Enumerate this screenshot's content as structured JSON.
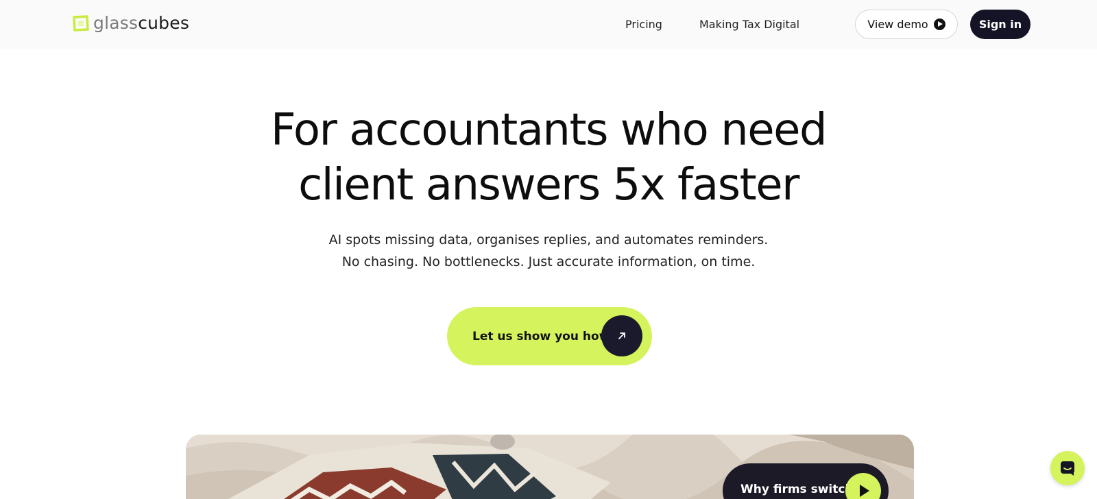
{
  "brand": {
    "name_light": "glass",
    "name_dark": "cubes",
    "accent": "#d5f35d",
    "dark": "#141426"
  },
  "nav": {
    "links": [
      "Pricing",
      "Making Tax Digital"
    ],
    "demo_label": "View demo",
    "signin_label": "Sign in"
  },
  "hero": {
    "title_line1": "For accountants who need",
    "title_line2_plain": "client answers ",
    "title_line2_highlight": "5x faster",
    "subtitle_line1": "AI spots missing data, organises replies, and automates reminders.",
    "subtitle_line2": "No chasing. No bottlenecks. Just accurate information, on time.",
    "cta_label": "Let us show you how"
  },
  "media": {
    "video_label": "Why firms switch"
  },
  "icons": {
    "logo": "square-logo-icon",
    "demo": "play-circle-icon",
    "cta": "arrow-up-right-icon",
    "video": "play-icon",
    "chat": "chat-icon"
  }
}
